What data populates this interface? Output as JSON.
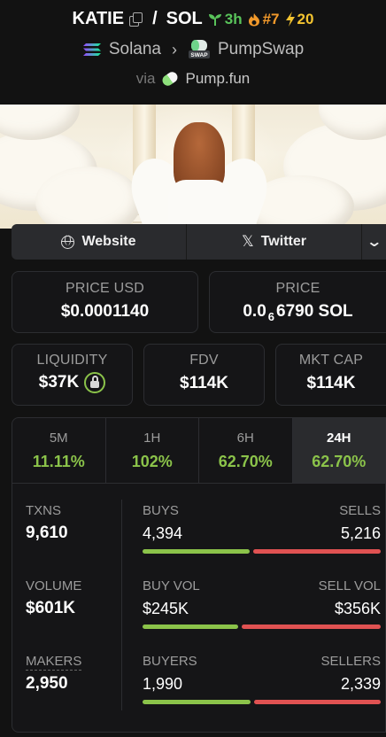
{
  "header": {
    "token": "KATIE",
    "slash": "/",
    "quote": "SOL",
    "age": "3h",
    "rank": "#7",
    "boosts": "20",
    "chain": "Solana",
    "dex": "PumpSwap",
    "dex_icon_text": "SWAP",
    "via_label": "via",
    "launchpad": "Pump.fun"
  },
  "links": {
    "website": "Website",
    "twitter": "Twitter"
  },
  "price": {
    "usd_label": "PRICE USD",
    "usd_value": "$0.0001140",
    "sol_label": "PRICE",
    "sol_prefix": "0.0",
    "sol_zeros": "6",
    "sol_digits": "6790 SOL"
  },
  "market": {
    "liquidity_label": "LIQUIDITY",
    "liquidity_value": "$37K",
    "fdv_label": "FDV",
    "fdv_value": "$114K",
    "mcap_label": "MKT CAP",
    "mcap_value": "$114K"
  },
  "timeframes": [
    {
      "label": "5M",
      "value": "11.11%"
    },
    {
      "label": "1H",
      "value": "102%"
    },
    {
      "label": "6H",
      "value": "62.70%"
    },
    {
      "label": "24H",
      "value": "62.70%",
      "active": true
    }
  ],
  "stats": {
    "txns_label": "TXNS",
    "txns_value": "9,610",
    "volume_label": "VOLUME",
    "volume_value": "$601K",
    "makers_label": "MAKERS",
    "makers_value": "2,950",
    "buys_label": "BUYS",
    "buys_value": "4,394",
    "sells_label": "SELLS",
    "sells_value": "5,216",
    "buys_fraction": 0.457,
    "buyvol_label": "BUY VOL",
    "buyvol_value": "$245K",
    "sellvol_label": "SELL VOL",
    "sellvol_value": "$356K",
    "buyvol_fraction": 0.408,
    "buyers_label": "BUYERS",
    "buyers_value": "1,990",
    "sellers_label": "SELLERS",
    "sellers_value": "2,339",
    "buyers_fraction": 0.46
  },
  "colors": {
    "positive": "#8bc34a",
    "negative": "#e05252",
    "age": "#59c35a",
    "rank": "#f39a2b",
    "boost": "#f4c430"
  }
}
